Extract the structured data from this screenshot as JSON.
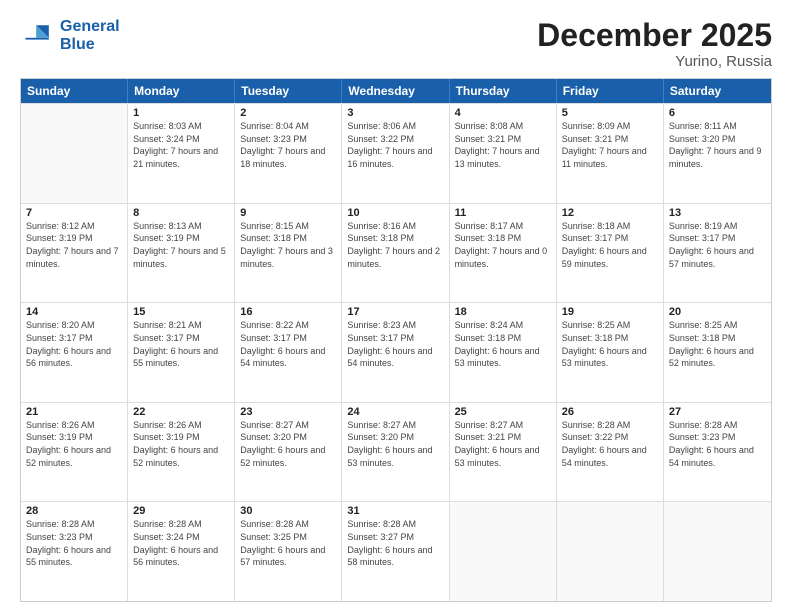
{
  "header": {
    "logo_line1": "General",
    "logo_line2": "Blue",
    "title": "December 2025",
    "subtitle": "Yurino, Russia"
  },
  "days": [
    "Sunday",
    "Monday",
    "Tuesday",
    "Wednesday",
    "Thursday",
    "Friday",
    "Saturday"
  ],
  "rows": [
    [
      {
        "day": "",
        "empty": true
      },
      {
        "day": "1",
        "sunrise": "8:03 AM",
        "sunset": "3:24 PM",
        "daylight": "7 hours and 21 minutes."
      },
      {
        "day": "2",
        "sunrise": "8:04 AM",
        "sunset": "3:23 PM",
        "daylight": "7 hours and 18 minutes."
      },
      {
        "day": "3",
        "sunrise": "8:06 AM",
        "sunset": "3:22 PM",
        "daylight": "7 hours and 16 minutes."
      },
      {
        "day": "4",
        "sunrise": "8:08 AM",
        "sunset": "3:21 PM",
        "daylight": "7 hours and 13 minutes."
      },
      {
        "day": "5",
        "sunrise": "8:09 AM",
        "sunset": "3:21 PM",
        "daylight": "7 hours and 11 minutes."
      },
      {
        "day": "6",
        "sunrise": "8:11 AM",
        "sunset": "3:20 PM",
        "daylight": "7 hours and 9 minutes."
      }
    ],
    [
      {
        "day": "7",
        "sunrise": "8:12 AM",
        "sunset": "3:19 PM",
        "daylight": "7 hours and 7 minutes."
      },
      {
        "day": "8",
        "sunrise": "8:13 AM",
        "sunset": "3:19 PM",
        "daylight": "7 hours and 5 minutes."
      },
      {
        "day": "9",
        "sunrise": "8:15 AM",
        "sunset": "3:18 PM",
        "daylight": "7 hours and 3 minutes."
      },
      {
        "day": "10",
        "sunrise": "8:16 AM",
        "sunset": "3:18 PM",
        "daylight": "7 hours and 2 minutes."
      },
      {
        "day": "11",
        "sunrise": "8:17 AM",
        "sunset": "3:18 PM",
        "daylight": "7 hours and 0 minutes."
      },
      {
        "day": "12",
        "sunrise": "8:18 AM",
        "sunset": "3:17 PM",
        "daylight": "6 hours and 59 minutes."
      },
      {
        "day": "13",
        "sunrise": "8:19 AM",
        "sunset": "3:17 PM",
        "daylight": "6 hours and 57 minutes."
      }
    ],
    [
      {
        "day": "14",
        "sunrise": "8:20 AM",
        "sunset": "3:17 PM",
        "daylight": "6 hours and 56 minutes."
      },
      {
        "day": "15",
        "sunrise": "8:21 AM",
        "sunset": "3:17 PM",
        "daylight": "6 hours and 55 minutes."
      },
      {
        "day": "16",
        "sunrise": "8:22 AM",
        "sunset": "3:17 PM",
        "daylight": "6 hours and 54 minutes."
      },
      {
        "day": "17",
        "sunrise": "8:23 AM",
        "sunset": "3:17 PM",
        "daylight": "6 hours and 54 minutes."
      },
      {
        "day": "18",
        "sunrise": "8:24 AM",
        "sunset": "3:18 PM",
        "daylight": "6 hours and 53 minutes."
      },
      {
        "day": "19",
        "sunrise": "8:25 AM",
        "sunset": "3:18 PM",
        "daylight": "6 hours and 53 minutes."
      },
      {
        "day": "20",
        "sunrise": "8:25 AM",
        "sunset": "3:18 PM",
        "daylight": "6 hours and 52 minutes."
      }
    ],
    [
      {
        "day": "21",
        "sunrise": "8:26 AM",
        "sunset": "3:19 PM",
        "daylight": "6 hours and 52 minutes."
      },
      {
        "day": "22",
        "sunrise": "8:26 AM",
        "sunset": "3:19 PM",
        "daylight": "6 hours and 52 minutes."
      },
      {
        "day": "23",
        "sunrise": "8:27 AM",
        "sunset": "3:20 PM",
        "daylight": "6 hours and 52 minutes."
      },
      {
        "day": "24",
        "sunrise": "8:27 AM",
        "sunset": "3:20 PM",
        "daylight": "6 hours and 53 minutes."
      },
      {
        "day": "25",
        "sunrise": "8:27 AM",
        "sunset": "3:21 PM",
        "daylight": "6 hours and 53 minutes."
      },
      {
        "day": "26",
        "sunrise": "8:28 AM",
        "sunset": "3:22 PM",
        "daylight": "6 hours and 54 minutes."
      },
      {
        "day": "27",
        "sunrise": "8:28 AM",
        "sunset": "3:23 PM",
        "daylight": "6 hours and 54 minutes."
      }
    ],
    [
      {
        "day": "28",
        "sunrise": "8:28 AM",
        "sunset": "3:23 PM",
        "daylight": "6 hours and 55 minutes."
      },
      {
        "day": "29",
        "sunrise": "8:28 AM",
        "sunset": "3:24 PM",
        "daylight": "6 hours and 56 minutes."
      },
      {
        "day": "30",
        "sunrise": "8:28 AM",
        "sunset": "3:25 PM",
        "daylight": "6 hours and 57 minutes."
      },
      {
        "day": "31",
        "sunrise": "8:28 AM",
        "sunset": "3:27 PM",
        "daylight": "6 hours and 58 minutes."
      },
      {
        "day": "",
        "empty": true
      },
      {
        "day": "",
        "empty": true
      },
      {
        "day": "",
        "empty": true
      }
    ]
  ]
}
